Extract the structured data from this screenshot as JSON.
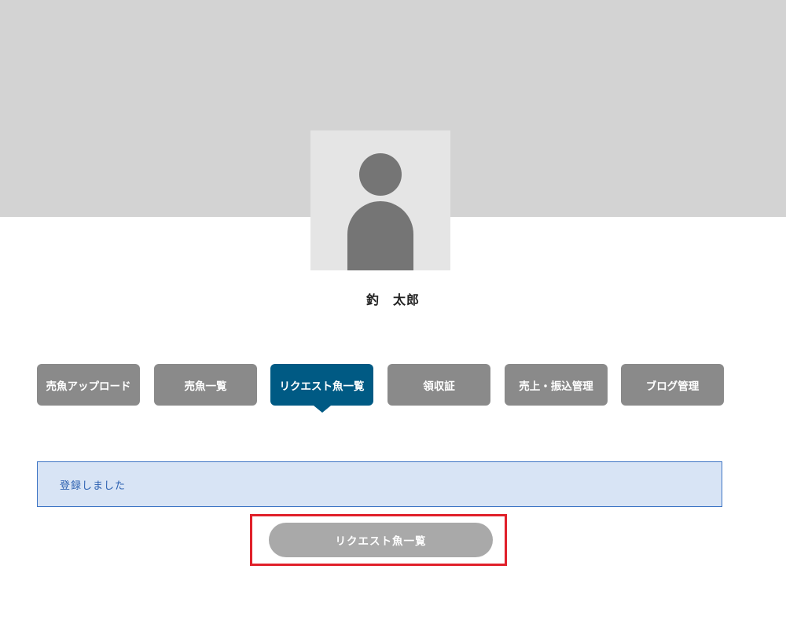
{
  "profile": {
    "name": "釣　太郎"
  },
  "tabs": [
    {
      "label": "売魚アップロード",
      "active": false
    },
    {
      "label": "売魚一覧",
      "active": false
    },
    {
      "label": "リクエスト魚一覧",
      "active": true
    },
    {
      "label": "領収証",
      "active": false
    },
    {
      "label": "売上・振込管理",
      "active": false
    },
    {
      "label": "ブログ管理",
      "active": false
    }
  ],
  "alert": {
    "message": "登録しました"
  },
  "actions": {
    "back_to_list_label": "リクエスト魚一覧"
  },
  "colors": {
    "cover": "#d3d3d3",
    "tab_default": "#8a8a8a",
    "tab_active": "#005a84",
    "alert_bg": "#d8e4f5",
    "alert_text": "#2a5fb0",
    "highlight": "#e0202a"
  }
}
